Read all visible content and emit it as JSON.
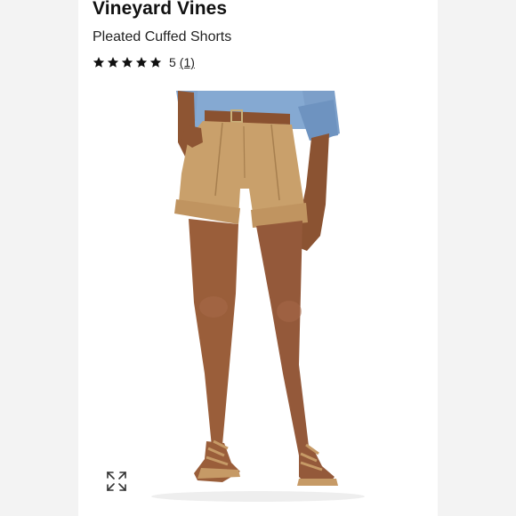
{
  "product": {
    "brand": "Vineyard Vines",
    "name": "Pleated Cuffed Shorts",
    "rating": {
      "stars": 5,
      "value_label": "5",
      "count_label": "(1)"
    }
  },
  "image": {
    "icon": "expand-icon"
  },
  "colors": {
    "shorts": "#c9a06b",
    "shirt": "#7ea4cf",
    "skin": "#9a5e3a",
    "belt": "#8a5130"
  }
}
